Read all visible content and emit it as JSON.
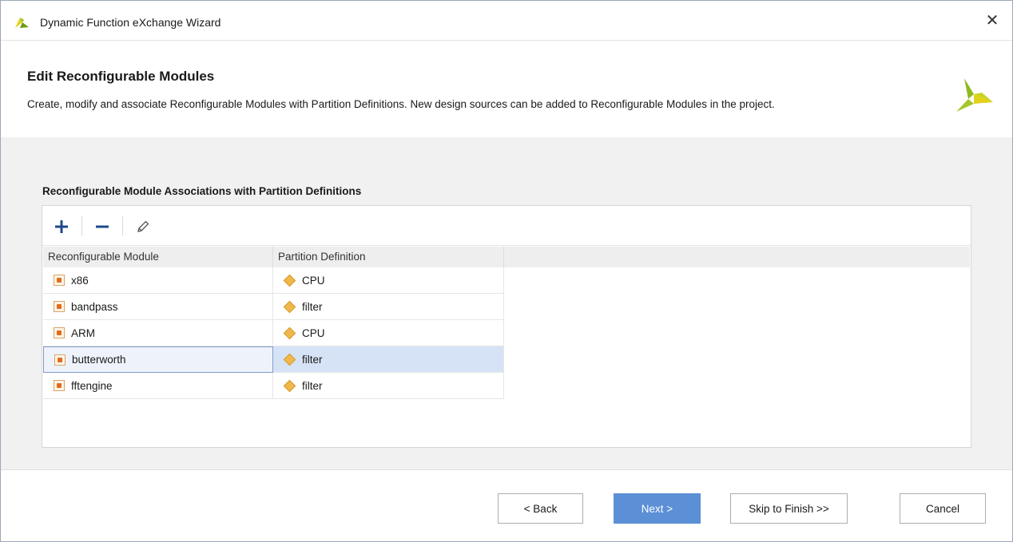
{
  "window": {
    "title": "Dynamic Function eXchange Wizard",
    "close_glyph": "✕"
  },
  "header": {
    "title": "Edit Reconfigurable Modules",
    "description": "Create, modify and associate Reconfigurable Modules with Partition Definitions. New design sources can be added to Reconfigurable Modules in the project."
  },
  "section": {
    "title": "Reconfigurable Module Associations with Partition Definitions"
  },
  "toolbar": {
    "add_icon": "plus-icon",
    "remove_icon": "minus-icon",
    "edit_icon": "pencil-icon"
  },
  "table": {
    "columns": [
      "Reconfigurable Module",
      "Partition Definition"
    ],
    "rows": [
      {
        "module": "x86",
        "partition": "CPU",
        "selected": false
      },
      {
        "module": "bandpass",
        "partition": "filter",
        "selected": false
      },
      {
        "module": "ARM",
        "partition": "CPU",
        "selected": false
      },
      {
        "module": "butterworth",
        "partition": "filter",
        "selected": true
      },
      {
        "module": "fftengine",
        "partition": "filter",
        "selected": false
      }
    ]
  },
  "buttons": {
    "back": "< Back",
    "next": "Next >",
    "skip": "Skip to Finish >>",
    "cancel": "Cancel"
  },
  "colors": {
    "accent": "#5b8fd6",
    "selection": "#d6e3f6",
    "logo_green": "#8dbb1d",
    "logo_yellow": "#e3d21b",
    "partition_icon": "#f0b84a",
    "module_icon": "#e06d1c"
  }
}
